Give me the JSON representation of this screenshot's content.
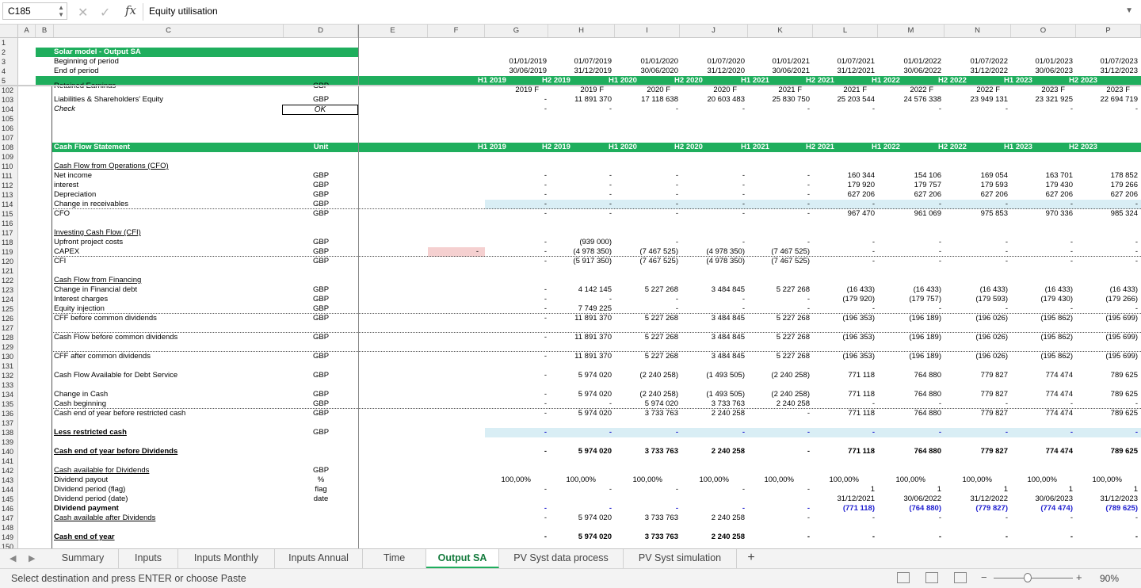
{
  "formula_bar": {
    "cell_ref": "C185",
    "content": "Equity utilisation"
  },
  "columns": [
    "A",
    "B",
    "C",
    "D",
    "E",
    "F",
    "G",
    "H",
    "I",
    "J",
    "K",
    "L",
    "M",
    "N",
    "O",
    "P"
  ],
  "header_rows": {
    "title": "Solar model - Output SA",
    "begin_label": "Beginning of period",
    "end_label": "End of period",
    "begin_dates": [
      "01/01/2019",
      "01/07/2019",
      "01/01/2020",
      "01/07/2020",
      "01/01/2021",
      "01/07/2021",
      "01/01/2022",
      "01/07/2022",
      "01/01/2023",
      "01/07/2023"
    ],
    "end_dates": [
      "30/06/2019",
      "31/12/2019",
      "30/06/2020",
      "31/12/2020",
      "30/06/2021",
      "31/12/2021",
      "30/06/2022",
      "31/12/2022",
      "30/06/2023",
      "31/12/2023"
    ],
    "periods": [
      "H1 2019",
      "H2 2019",
      "H1 2020",
      "H2 2020",
      "H1 2021",
      "H2 2021",
      "H1 2022",
      "H2 2022",
      "H1 2023",
      "H2 2023"
    ],
    "fy": [
      "2019 F",
      "2019 F",
      "2020 F",
      "2020 F",
      "2021 F",
      "2021 F",
      "2022 F",
      "2022 F",
      "2023 F",
      "2023 F"
    ]
  },
  "rows": [
    {
      "n": "102",
      "label": "Retained Earnings",
      "unit": "GBP",
      "vals": [
        "",
        "",
        "",
        "",
        "",
        "",
        "",
        "",
        "",
        ""
      ],
      "cls": "clipped"
    },
    {
      "n": "103",
      "label": "Liabilities & Shareholders' Equity",
      "unit": "GBP",
      "vals": [
        "-",
        "11 891 370",
        "17 118 638",
        "20 603 483",
        "25 830 750",
        "25 203 544",
        "24 576 338",
        "23 949 131",
        "23 321 925",
        "22 694 719"
      ]
    },
    {
      "n": "104",
      "label": "Check",
      "unit": "OK",
      "vals": [
        "-",
        "-",
        "-",
        "-",
        "-",
        "-",
        "-",
        "-",
        "-",
        "-"
      ],
      "cls": "check"
    },
    {
      "n": "105",
      "label": "",
      "unit": "",
      "vals": []
    },
    {
      "n": "106",
      "label": "",
      "unit": "",
      "vals": []
    },
    {
      "n": "107",
      "label": "",
      "unit": "",
      "vals": []
    },
    {
      "n": "108",
      "label": "Cash Flow Statement",
      "unit": "Unit",
      "vals": [
        "H1 2019",
        "H2 2019",
        "H1 2020",
        "H2 2020",
        "H1 2021",
        "H2 2021",
        "H1 2022",
        "H2 2022",
        "H1 2023",
        "H2 2023"
      ],
      "cls": "section"
    },
    {
      "n": "109",
      "label": "",
      "unit": "",
      "vals": []
    },
    {
      "n": "110",
      "label": "Cash Flow from Operations (CFO)",
      "unit": "",
      "vals": [],
      "cls": "u"
    },
    {
      "n": "111",
      "label": "Net income",
      "unit": "GBP",
      "vals": [
        "-",
        "-",
        "-",
        "-",
        "-",
        "160 344",
        "154 106",
        "169 054",
        "163 701",
        "178 852"
      ]
    },
    {
      "n": "112",
      "label": "interest",
      "unit": "GBP",
      "vals": [
        "-",
        "-",
        "-",
        "-",
        "-",
        "179 920",
        "179 757",
        "179 593",
        "179 430",
        "179 266"
      ]
    },
    {
      "n": "113",
      "label": "Depreciation",
      "unit": "GBP",
      "vals": [
        "-",
        "-",
        "-",
        "-",
        "-",
        "627 206",
        "627 206",
        "627 206",
        "627 206",
        "627 206"
      ]
    },
    {
      "n": "114",
      "label": "Change in receivables",
      "unit": "GBP",
      "vals": [
        "-",
        "-",
        "-",
        "-",
        "-",
        "-",
        "-",
        "-",
        "-",
        "-"
      ],
      "cls": "lb"
    },
    {
      "n": "115",
      "label": "CFO",
      "unit": "GBP",
      "vals": [
        "-",
        "-",
        "-",
        "-",
        "-",
        "967 470",
        "961 069",
        "975 853",
        "970 336",
        "985 324"
      ],
      "cls": "dotline"
    },
    {
      "n": "116",
      "label": "",
      "unit": "",
      "vals": []
    },
    {
      "n": "117",
      "label": "Investing Cash Flow (CFI)",
      "unit": "",
      "vals": [],
      "cls": "u"
    },
    {
      "n": "118",
      "label": "Upfront project costs",
      "unit": "GBP",
      "vals": [
        "-",
        "(939 000)",
        "-",
        "-",
        "-",
        "-",
        "-",
        "-",
        "-",
        "-"
      ]
    },
    {
      "n": "119",
      "label": "CAPEX",
      "unit": "GBP",
      "vals": [
        "-",
        "(4 978 350)",
        "(7 467 525)",
        "(4 978 350)",
        "(7 467 525)",
        "-",
        "-",
        "-",
        "-",
        "-"
      ],
      "cls": "pinkF"
    },
    {
      "n": "120",
      "label": "CFI",
      "unit": "GBP",
      "vals": [
        "-",
        "(5 917 350)",
        "(7 467 525)",
        "(4 978 350)",
        "(7 467 525)",
        "-",
        "-",
        "-",
        "-",
        "-"
      ],
      "cls": "dotline"
    },
    {
      "n": "121",
      "label": "",
      "unit": "",
      "vals": []
    },
    {
      "n": "122",
      "label": "Cash Flow from Financing",
      "unit": "",
      "vals": [],
      "cls": "u"
    },
    {
      "n": "123",
      "label": "Change in Financial debt",
      "unit": "GBP",
      "vals": [
        "-",
        "4 142 145",
        "5 227 268",
        "3 484 845",
        "5 227 268",
        "(16 433)",
        "(16 433)",
        "(16 433)",
        "(16 433)",
        "(16 433)"
      ]
    },
    {
      "n": "124",
      "label": "Interest charges",
      "unit": "GBP",
      "vals": [
        "-",
        "-",
        "-",
        "-",
        "-",
        "(179 920)",
        "(179 757)",
        "(179 593)",
        "(179 430)",
        "(179 266)"
      ]
    },
    {
      "n": "125",
      "label": "Equity injection",
      "unit": "GBP",
      "vals": [
        "-",
        "7 749 225",
        "-",
        "-",
        "-",
        "-",
        "-",
        "-",
        "-",
        "-"
      ]
    },
    {
      "n": "126",
      "label": "CFF before common dividends",
      "unit": "GBP",
      "vals": [
        "-",
        "11 891 370",
        "5 227 268",
        "3 484 845",
        "5 227 268",
        "(196 353)",
        "(196 189)",
        "(196 026)",
        "(195 862)",
        "(195 699)"
      ],
      "cls": "dotline"
    },
    {
      "n": "127",
      "label": "",
      "unit": "",
      "vals": []
    },
    {
      "n": "128",
      "label": "Cash Flow before common dividends",
      "unit": "GBP",
      "vals": [
        "-",
        "11 891 370",
        "5 227 268",
        "3 484 845",
        "5 227 268",
        "(196 353)",
        "(196 189)",
        "(196 026)",
        "(195 862)",
        "(195 699)"
      ],
      "cls": "dotline"
    },
    {
      "n": "129",
      "label": "",
      "unit": "",
      "vals": []
    },
    {
      "n": "130",
      "label": "CFF after common dividends",
      "unit": "GBP",
      "vals": [
        "-",
        "11 891 370",
        "5 227 268",
        "3 484 845",
        "5 227 268",
        "(196 353)",
        "(196 189)",
        "(196 026)",
        "(195 862)",
        "(195 699)"
      ],
      "cls": "dotline"
    },
    {
      "n": "131",
      "label": "",
      "unit": "",
      "vals": []
    },
    {
      "n": "132",
      "label": "Cash Flow Available for Debt Service",
      "unit": "GBP",
      "vals": [
        "-",
        "5 974 020",
        "(2 240 258)",
        "(1 493 505)",
        "(2 240 258)",
        "771 118",
        "764 880",
        "779 827",
        "774 474",
        "789 625"
      ]
    },
    {
      "n": "133",
      "label": "",
      "unit": "",
      "vals": []
    },
    {
      "n": "134",
      "label": "Change in Cash",
      "unit": "GBP",
      "vals": [
        "-",
        "5 974 020",
        "(2 240 258)",
        "(1 493 505)",
        "(2 240 258)",
        "771 118",
        "764 880",
        "779 827",
        "774 474",
        "789 625"
      ]
    },
    {
      "n": "135",
      "label": "Cash beginning",
      "unit": "GBP",
      "vals": [
        "-",
        "-",
        "5 974 020",
        "3 733 763",
        "2 240 258",
        "-",
        "-",
        "-",
        "-",
        "-"
      ]
    },
    {
      "n": "136",
      "label": "Cash end of year before restricted cash",
      "unit": "GBP",
      "vals": [
        "-",
        "5 974 020",
        "3 733 763",
        "2 240 258",
        "-",
        "771 118",
        "764 880",
        "779 827",
        "774 474",
        "789 625"
      ],
      "cls": "dotline"
    },
    {
      "n": "137",
      "label": "",
      "unit": "",
      "vals": []
    },
    {
      "n": "138",
      "label": "Less restricted cash",
      "unit": "GBP",
      "vals": [
        "-",
        "-",
        "-",
        "-",
        "-",
        "-",
        "-",
        "-",
        "-",
        "-"
      ],
      "cls": "restricted"
    },
    {
      "n": "139",
      "label": "",
      "unit": "",
      "vals": []
    },
    {
      "n": "140",
      "label": "Cash end of year before Dividends",
      "unit": "",
      "vals": [
        "-",
        "5 974 020",
        "3 733 763",
        "2 240 258",
        "-",
        "771 118",
        "764 880",
        "779 827",
        "774 474",
        "789 625"
      ],
      "cls": "boldu"
    },
    {
      "n": "141",
      "label": "",
      "unit": "",
      "vals": []
    },
    {
      "n": "142",
      "label": "Cash available for Dividends",
      "unit": "GBP",
      "vals": [],
      "cls": "u"
    },
    {
      "n": "143",
      "label": "Dividend payout",
      "unit": "%",
      "vals": [
        "100,00%",
        "100,00%",
        "100,00%",
        "100,00%",
        "100,00%",
        "100,00%",
        "100,00%",
        "100,00%",
        "100,00%",
        "100,00%"
      ],
      "cls": "pct"
    },
    {
      "n": "144",
      "label": "Dividend period (flag)",
      "unit": "flag",
      "vals": [
        "-",
        "-",
        "-",
        "-",
        "-",
        "1",
        "1",
        "1",
        "1",
        "1"
      ]
    },
    {
      "n": "145",
      "label": "Dividend period (date)",
      "unit": "date",
      "vals": [
        "",
        "",
        "",
        "",
        "",
        "31/12/2021",
        "30/06/2022",
        "31/12/2022",
        "30/06/2023",
        "31/12/2023"
      ]
    },
    {
      "n": "146",
      "label": "Dividend payment",
      "unit": "",
      "vals": [
        "-",
        "-",
        "-",
        "-",
        "-",
        "(771 118)",
        "(764 880)",
        "(779 827)",
        "(774 474)",
        "(789 625)"
      ],
      "cls": "divpay"
    },
    {
      "n": "147",
      "label": "Cash available after Dividends",
      "unit": "",
      "vals": [
        "-",
        "5 974 020",
        "3 733 763",
        "2 240 258",
        "-",
        "-",
        "-",
        "-",
        "-",
        "-"
      ],
      "cls": "u"
    },
    {
      "n": "148",
      "label": "",
      "unit": "",
      "vals": []
    },
    {
      "n": "149",
      "label": "Cash end of year",
      "unit": "",
      "vals": [
        "-",
        "5 974 020",
        "3 733 763",
        "2 240 258",
        "-",
        "-",
        "-",
        "-",
        "-",
        "-"
      ],
      "cls": "boldu"
    },
    {
      "n": "150",
      "label": "",
      "unit": "",
      "vals": []
    }
  ],
  "sheet_tabs": [
    "Summary",
    "Inputs",
    "Inputs Monthly",
    "Inputs Annual",
    "Time",
    "Output SA",
    "PV Syst data process",
    "PV Syst simulation"
  ],
  "active_tab": "Output SA",
  "status": {
    "message": "Select destination and press ENTER or choose Paste",
    "zoom": "90%"
  }
}
